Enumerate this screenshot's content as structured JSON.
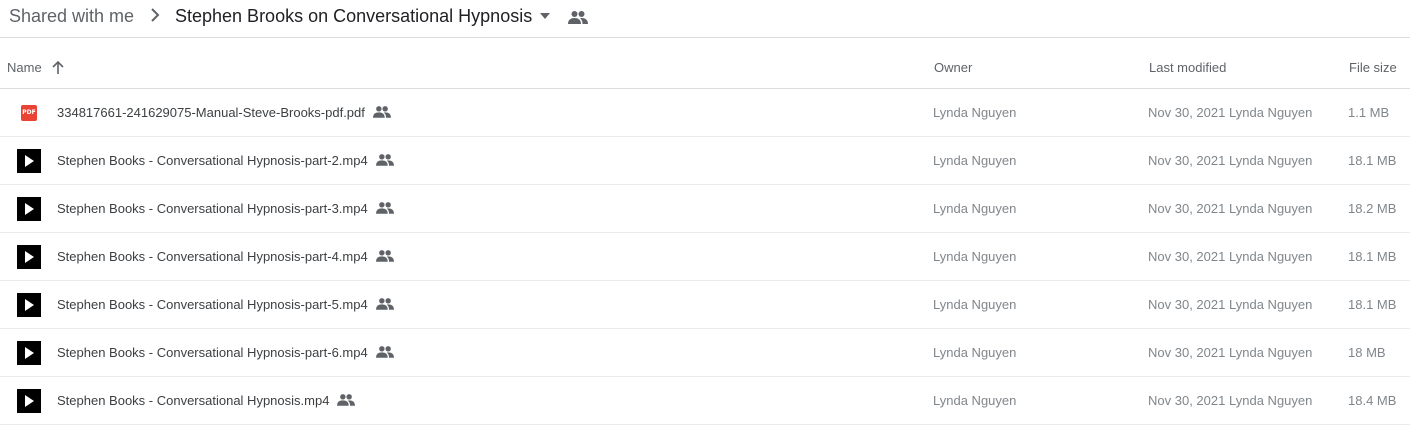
{
  "breadcrumb": {
    "root": "Shared with me",
    "current": "Stephen Brooks on Conversational Hypnosis"
  },
  "columns": {
    "name": "Name",
    "owner": "Owner",
    "last_modified": "Last modified",
    "file_size": "File size"
  },
  "rows": [
    {
      "name": "334817661-241629075-Manual-Steve-Brooks-pdf.pdf",
      "type": "pdf",
      "owner": "Lynda Nguyen",
      "modified_date": "Nov 30, 2021",
      "modified_by": "Lynda Nguyen",
      "size": "1.1 MB"
    },
    {
      "name": "Stephen Books - Conversational Hypnosis-part-2.mp4",
      "type": "video",
      "owner": "Lynda Nguyen",
      "modified_date": "Nov 30, 2021",
      "modified_by": "Lynda Nguyen",
      "size": "18.1 MB"
    },
    {
      "name": "Stephen Books - Conversational Hypnosis-part-3.mp4",
      "type": "video",
      "owner": "Lynda Nguyen",
      "modified_date": "Nov 30, 2021",
      "modified_by": "Lynda Nguyen",
      "size": "18.2 MB"
    },
    {
      "name": "Stephen Books - Conversational Hypnosis-part-4.mp4",
      "type": "video",
      "owner": "Lynda Nguyen",
      "modified_date": "Nov 30, 2021",
      "modified_by": "Lynda Nguyen",
      "size": "18.1 MB"
    },
    {
      "name": "Stephen Books - Conversational Hypnosis-part-5.mp4",
      "type": "video",
      "owner": "Lynda Nguyen",
      "modified_date": "Nov 30, 2021",
      "modified_by": "Lynda Nguyen",
      "size": "18.1 MB"
    },
    {
      "name": "Stephen Books - Conversational Hypnosis-part-6.mp4",
      "type": "video",
      "owner": "Lynda Nguyen",
      "modified_date": "Nov 30, 2021",
      "modified_by": "Lynda Nguyen",
      "size": "18 MB"
    },
    {
      "name": "Stephen Books - Conversational Hypnosis.mp4",
      "type": "video",
      "owner": "Lynda Nguyen",
      "modified_date": "Nov 30, 2021",
      "modified_by": "Lynda Nguyen",
      "size": "18.4 MB"
    }
  ],
  "icons": {
    "pdf_label": "PDF",
    "sort": "arrow-up-icon",
    "shared": "people-icon",
    "separator": "chevron-right-icon",
    "caret": "caret-down-icon"
  },
  "colors": {
    "pdf": "#ea4335",
    "video": "#000000",
    "text_muted": "#80868b"
  }
}
